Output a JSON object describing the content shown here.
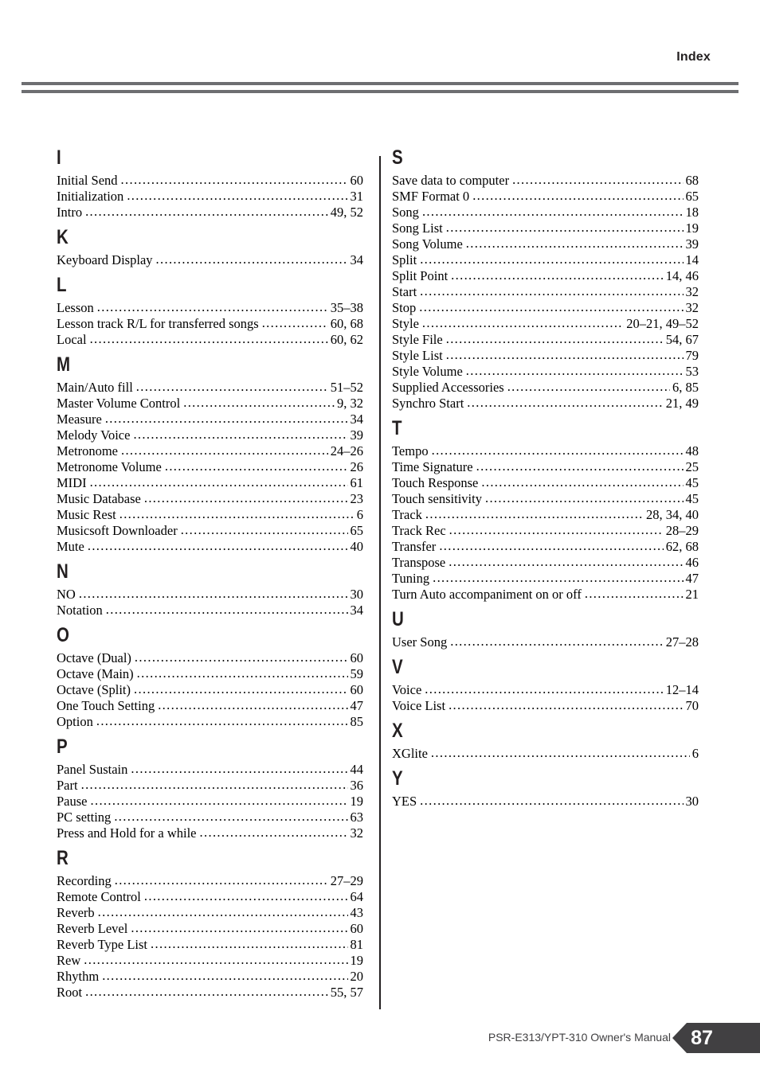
{
  "header": {
    "title": "Index"
  },
  "footer": {
    "manual_title": "PSR-E313/YPT-310   Owner's Manual",
    "page_number": "87"
  },
  "colors": {
    "rule_gray": "#6d6e71",
    "tab_dark": "#414042",
    "text_black": "#000000"
  },
  "columns": [
    {
      "sections": [
        {
          "letter": "I",
          "entries": [
            {
              "term": "Initial Send",
              "pages": "60"
            },
            {
              "term": "Initialization",
              "pages": "31"
            },
            {
              "term": "Intro",
              "pages": "49, 52"
            }
          ]
        },
        {
          "letter": "K",
          "entries": [
            {
              "term": "Keyboard Display",
              "pages": "34"
            }
          ]
        },
        {
          "letter": "L",
          "entries": [
            {
              "term": "Lesson",
              "pages": "35–38"
            },
            {
              "term": "Lesson track R/L for transferred songs",
              "pages": "60, 68"
            },
            {
              "term": "Local",
              "pages": "60, 62"
            }
          ]
        },
        {
          "letter": "M",
          "entries": [
            {
              "term": "Main/Auto fill",
              "pages": "51–52"
            },
            {
              "term": "Master Volume Control",
              "pages": "9, 32"
            },
            {
              "term": "Measure",
              "pages": "34"
            },
            {
              "term": "Melody Voice",
              "pages": "39"
            },
            {
              "term": "Metronome",
              "pages": "24–26"
            },
            {
              "term": "Metronome Volume",
              "pages": "26"
            },
            {
              "term": "MIDI",
              "pages": "61"
            },
            {
              "term": "Music Database",
              "pages": "23"
            },
            {
              "term": "Music Rest",
              "pages": "6"
            },
            {
              "term": "Musicsoft Downloader",
              "pages": "65"
            },
            {
              "term": "Mute",
              "pages": "40"
            }
          ]
        },
        {
          "letter": "N",
          "entries": [
            {
              "term": "NO",
              "pages": "30"
            },
            {
              "term": "Notation",
              "pages": "34"
            }
          ]
        },
        {
          "letter": "O",
          "entries": [
            {
              "term": "Octave (Dual)",
              "pages": "60"
            },
            {
              "term": "Octave (Main)",
              "pages": "59"
            },
            {
              "term": "Octave (Split)",
              "pages": "60"
            },
            {
              "term": "One Touch Setting",
              "pages": "47"
            },
            {
              "term": "Option",
              "pages": "85"
            }
          ]
        },
        {
          "letter": "P",
          "entries": [
            {
              "term": "Panel Sustain",
              "pages": "44"
            },
            {
              "term": "Part",
              "pages": "36"
            },
            {
              "term": "Pause",
              "pages": "19"
            },
            {
              "term": "PC setting",
              "pages": "63"
            },
            {
              "term": "Press and Hold for a while",
              "pages": "32"
            }
          ]
        },
        {
          "letter": "R",
          "entries": [
            {
              "term": "Recording",
              "pages": "27–29"
            },
            {
              "term": "Remote Control",
              "pages": "64"
            },
            {
              "term": "Reverb",
              "pages": "43"
            },
            {
              "term": "Reverb Level",
              "pages": "60"
            },
            {
              "term": "Reverb Type List",
              "pages": "81"
            },
            {
              "term": "Rew",
              "pages": "19"
            },
            {
              "term": "Rhythm",
              "pages": "20"
            },
            {
              "term": "Root",
              "pages": "55, 57"
            }
          ]
        }
      ]
    },
    {
      "sections": [
        {
          "letter": "S",
          "entries": [
            {
              "term": "Save data to computer",
              "pages": "68"
            },
            {
              "term": "SMF Format 0",
              "pages": "65"
            },
            {
              "term": "Song",
              "pages": "18"
            },
            {
              "term": "Song List",
              "pages": "19"
            },
            {
              "term": "Song Volume",
              "pages": "39"
            },
            {
              "term": "Split",
              "pages": "14"
            },
            {
              "term": "Split Point",
              "pages": "14, 46"
            },
            {
              "term": "Start",
              "pages": "32"
            },
            {
              "term": "Stop",
              "pages": "32"
            },
            {
              "term": "Style",
              "pages": "20–21, 49–52"
            },
            {
              "term": "Style File",
              "pages": "54, 67"
            },
            {
              "term": "Style List",
              "pages": "79"
            },
            {
              "term": "Style Volume",
              "pages": "53"
            },
            {
              "term": "Supplied Accessories",
              "pages": "6, 85"
            },
            {
              "term": "Synchro Start",
              "pages": "21, 49"
            }
          ]
        },
        {
          "letter": "T",
          "entries": [
            {
              "term": "Tempo",
              "pages": "48"
            },
            {
              "term": "Time Signature",
              "pages": "25"
            },
            {
              "term": "Touch Response",
              "pages": "45"
            },
            {
              "term": "Touch sensitivity",
              "pages": "45"
            },
            {
              "term": "Track",
              "pages": "28, 34, 40"
            },
            {
              "term": "Track Rec",
              "pages": "28–29"
            },
            {
              "term": "Transfer",
              "pages": "62, 68"
            },
            {
              "term": "Transpose",
              "pages": "46"
            },
            {
              "term": "Tuning",
              "pages": "47"
            },
            {
              "term": "Turn Auto accompaniment on or off",
              "pages": "21"
            }
          ]
        },
        {
          "letter": "U",
          "entries": [
            {
              "term": "User Song",
              "pages": "27–28"
            }
          ]
        },
        {
          "letter": "V",
          "entries": [
            {
              "term": "Voice",
              "pages": "12–14"
            },
            {
              "term": "Voice List",
              "pages": "70"
            }
          ]
        },
        {
          "letter": "X",
          "entries": [
            {
              "term": "XGlite",
              "pages": "6"
            }
          ]
        },
        {
          "letter": "Y",
          "entries": [
            {
              "term": "YES",
              "pages": "30"
            }
          ]
        }
      ]
    }
  ]
}
